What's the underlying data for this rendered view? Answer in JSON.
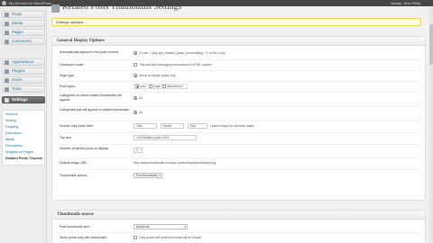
{
  "adminbar": {
    "site_name": "My Director for WordPress",
    "howdy": "Howdy, Tech Philly"
  },
  "sidebar": {
    "items": [
      {
        "label": "Posts",
        "icon": "pin-icon"
      },
      {
        "label": "Media",
        "icon": "media-icon"
      },
      {
        "label": "Pages",
        "icon": "page-icon"
      },
      {
        "label": "Comments",
        "icon": "comment-icon"
      },
      {
        "label": "Appearance",
        "icon": "appearance-icon"
      },
      {
        "label": "Plugins",
        "icon": "plugin-icon"
      },
      {
        "label": "Users",
        "icon": "users-icon"
      },
      {
        "label": "Tools",
        "icon": "tools-icon"
      },
      {
        "label": "Settings",
        "icon": "settings-icon"
      }
    ],
    "submenu": [
      "General",
      "Writing",
      "Reading",
      "Discussion",
      "Media",
      "Permalinks",
      "Widgets on Pages",
      "Related Posts Thumbn"
    ]
  },
  "page": {
    "title": "Related Posts Thumbnails Settings",
    "notice": "Settings updated."
  },
  "general": {
    "heading": "General Display Options",
    "rows": {
      "auto_label": "Automatically append to the post content:",
      "auto_text": "Or use <?php get_related_posts_thumbnails(); ?> in the Loop",
      "dev_label": "Developer mode:",
      "dev_text": "This will add debugging information in HTML source",
      "pagetype_label": "Page type:",
      "pagetype_text": "Show on single posts only",
      "posttypes_label": "Post types:",
      "posttypes_post": "post",
      "posttypes_page": "page",
      "posttypes_attachment": "attachment",
      "cats_label": "Categories on which related thumbnails will appear:",
      "cats_all": "All",
      "cats2_label": "Categories that will appear in related thumbnails:",
      "cats2_all": "All",
      "after_label": "Include only posts after:",
      "after_year": "Year",
      "after_month": "Month",
      "after_day": "Day",
      "after_note": "Leave empty for all posts dates",
      "top_label": "Top text:",
      "top_value": "<h3>Related posts:</h3>",
      "number_label": "Number of similar posts to display:",
      "number_value": "3",
      "default_label": "Default image URL:",
      "default_value": "http://www.thumbnails.com/wp-content/uploads/default.png",
      "source_label": "Thumbnails source:",
      "source_value": "Post thumbnails"
    }
  },
  "thumbs": {
    "heading": "Thumbnails source",
    "rows": {
      "thumbsize_label": "Post thumbnails size:",
      "thumbsize_value": "thumbnail",
      "noimage_label": "Show posts only with thumbnails:",
      "noimage_text": "Only posts with post thumbnail will be shown"
    }
  }
}
